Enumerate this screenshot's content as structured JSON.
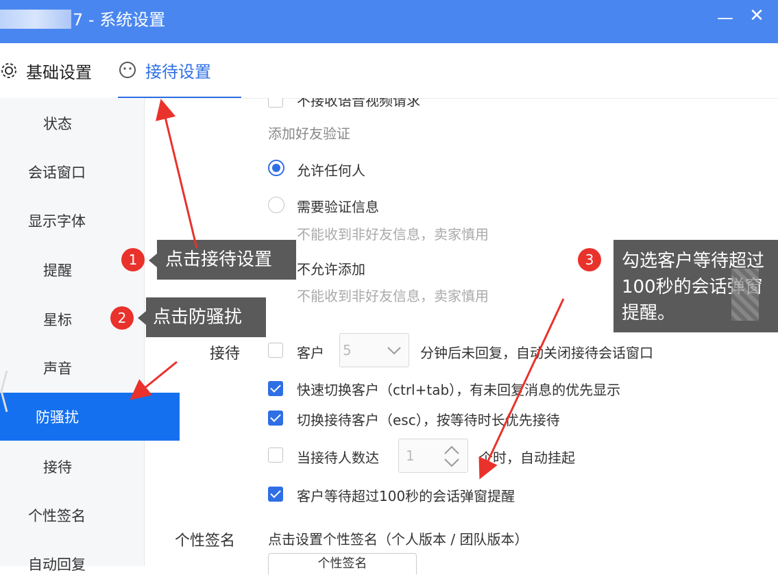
{
  "window": {
    "title": "7 - 系统设置",
    "minimize": "—",
    "close": "✕"
  },
  "tabs": [
    {
      "label": "基础设置",
      "icon": "gear-icon"
    },
    {
      "label": "接待设置",
      "icon": "smiley-face-icon",
      "active": true
    }
  ],
  "sidebar": {
    "items": [
      "状态",
      "会话窗口",
      "显示字体",
      "提醒",
      "星标",
      "声音",
      "防骚扰",
      "接待",
      "个性签名",
      "自动回复"
    ],
    "active": "防骚扰"
  },
  "main": {
    "cut_top_option": "不接收语音视频请求",
    "friend_verify_label": "添加好友验证",
    "radios": [
      {
        "label": "允许任何人",
        "checked": true
      },
      {
        "label": "需要验证信息",
        "checked": false,
        "hint": "不能收到非好友信息，卖家慎用"
      },
      {
        "label": "不允许添加",
        "checked": false,
        "hint": "不能收到非好友信息，卖家慎用"
      }
    ],
    "reception": {
      "section_label": "接待",
      "auto_close": {
        "prefix": "客户",
        "minutes": "5",
        "suffix": "分钟后未回复，自动关闭接待会话窗口",
        "checked": false
      },
      "quick_switch": {
        "label": "快速切换客户（ctrl+tab），有未回复消息的优先显示",
        "checked": true
      },
      "switch_wait": {
        "label": "切换接待客户（esc），按等待时长优先接待",
        "checked": true
      },
      "auto_suspend": {
        "prefix": "当接待人数达",
        "count": "1",
        "suffix": "个时，自动挂起",
        "checked": false
      },
      "wait_popup": {
        "label": "客户等待超过100秒的会话弹窗提醒",
        "checked": true
      }
    },
    "signature": {
      "section_label": "个性签名",
      "hint": "点击设置个性签名（个人版本 / 团队版本）",
      "button": "个性签名"
    }
  },
  "annotations": [
    {
      "number": "1",
      "text": "点击接待设置"
    },
    {
      "number": "2",
      "text": "点击防骚扰"
    },
    {
      "number": "3",
      "lines": [
        "勾选客户等待超过",
        "100秒的会话弹窗",
        "提醒。"
      ]
    }
  ],
  "colors": {
    "titlebar": "#4a86f0",
    "accent": "#2f6fe4",
    "active_sidebar": "#1570ef",
    "badge": "#e8322b",
    "callout": "#5a5a5a",
    "arrow": "#e8322b"
  }
}
